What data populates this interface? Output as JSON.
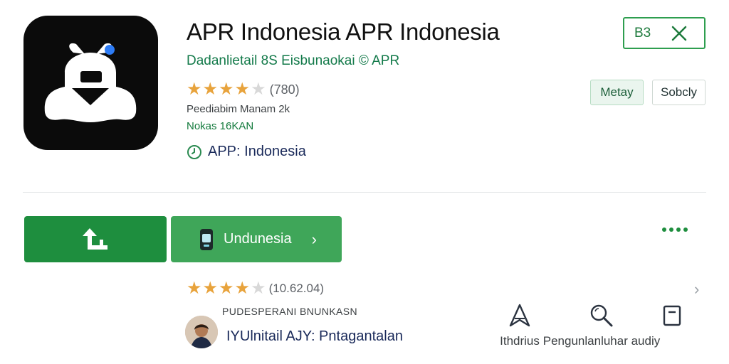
{
  "header": {
    "title": "APR Indonesia APR Indonesia",
    "developer": "Dadanlietail 8S Eisbunaokai © APR",
    "rating_count": "(780)",
    "downloads": "Peediabim Manam 2k",
    "size": "Nokas 16KAN",
    "verified_label": "APP: Indonesia"
  },
  "top_right": {
    "corner_label": "B3",
    "chip_1": "Metay",
    "chip_2": "Sobcly"
  },
  "actions": {
    "install_label": "Undunesia",
    "install_chevron": "›"
  },
  "rating": {
    "stars": 4,
    "rating_count": "(10.62.04)"
  },
  "review": {
    "heading": "PUDESPERANI BNUNKASN",
    "text": "IYUlnitail AJY: Pntagantalan"
  },
  "bottom_actions": [
    {
      "label": "Ithdrius",
      "icon": "navigation-arrow-icon"
    },
    {
      "label": "Pengunlanluhar audiy",
      "icon": "magnifier-icon"
    },
    {
      "label": "",
      "icon": "bookmark-icon"
    }
  ],
  "colors": {
    "brand_green": "#1e8e3e",
    "install_green": "#3fa659",
    "star_gold": "#e8a33c",
    "icon_bg": "#0b0b0b"
  }
}
